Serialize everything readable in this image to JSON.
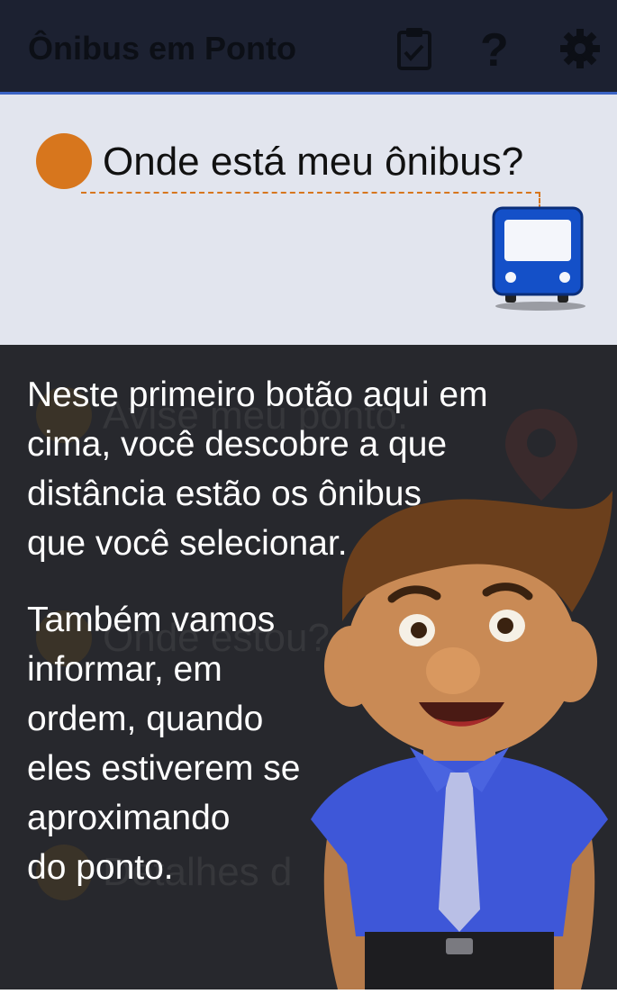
{
  "app": {
    "title": "Ônibus em Ponto"
  },
  "toolbar": {
    "icons": [
      "checklist-icon",
      "help-icon",
      "settings-icon"
    ]
  },
  "highlight_card": {
    "title": "Onde está meu ônibus?",
    "icon": "bus-icon"
  },
  "background_items": [
    {
      "label": "Avise meu ponto."
    },
    {
      "label": "Onde estou?"
    },
    {
      "label": "Detalhes d"
    }
  ],
  "narration": {
    "paragraph1_lines": [
      "Neste primeiro botão aqui em",
      "cima, você descobre a que",
      "distância estão os ônibus",
      "que você selecionar."
    ],
    "paragraph2_lines": [
      "Também vamos",
      "informar, em",
      "ordem, quando",
      "eles estiverem se",
      "aproximando",
      "do ponto."
    ]
  },
  "colors": {
    "appbar": "#1c2131",
    "accent_blue": "#3b63c4",
    "orange": "#d7761d",
    "card": "#e2e5ee",
    "overlay": "#27282d"
  }
}
